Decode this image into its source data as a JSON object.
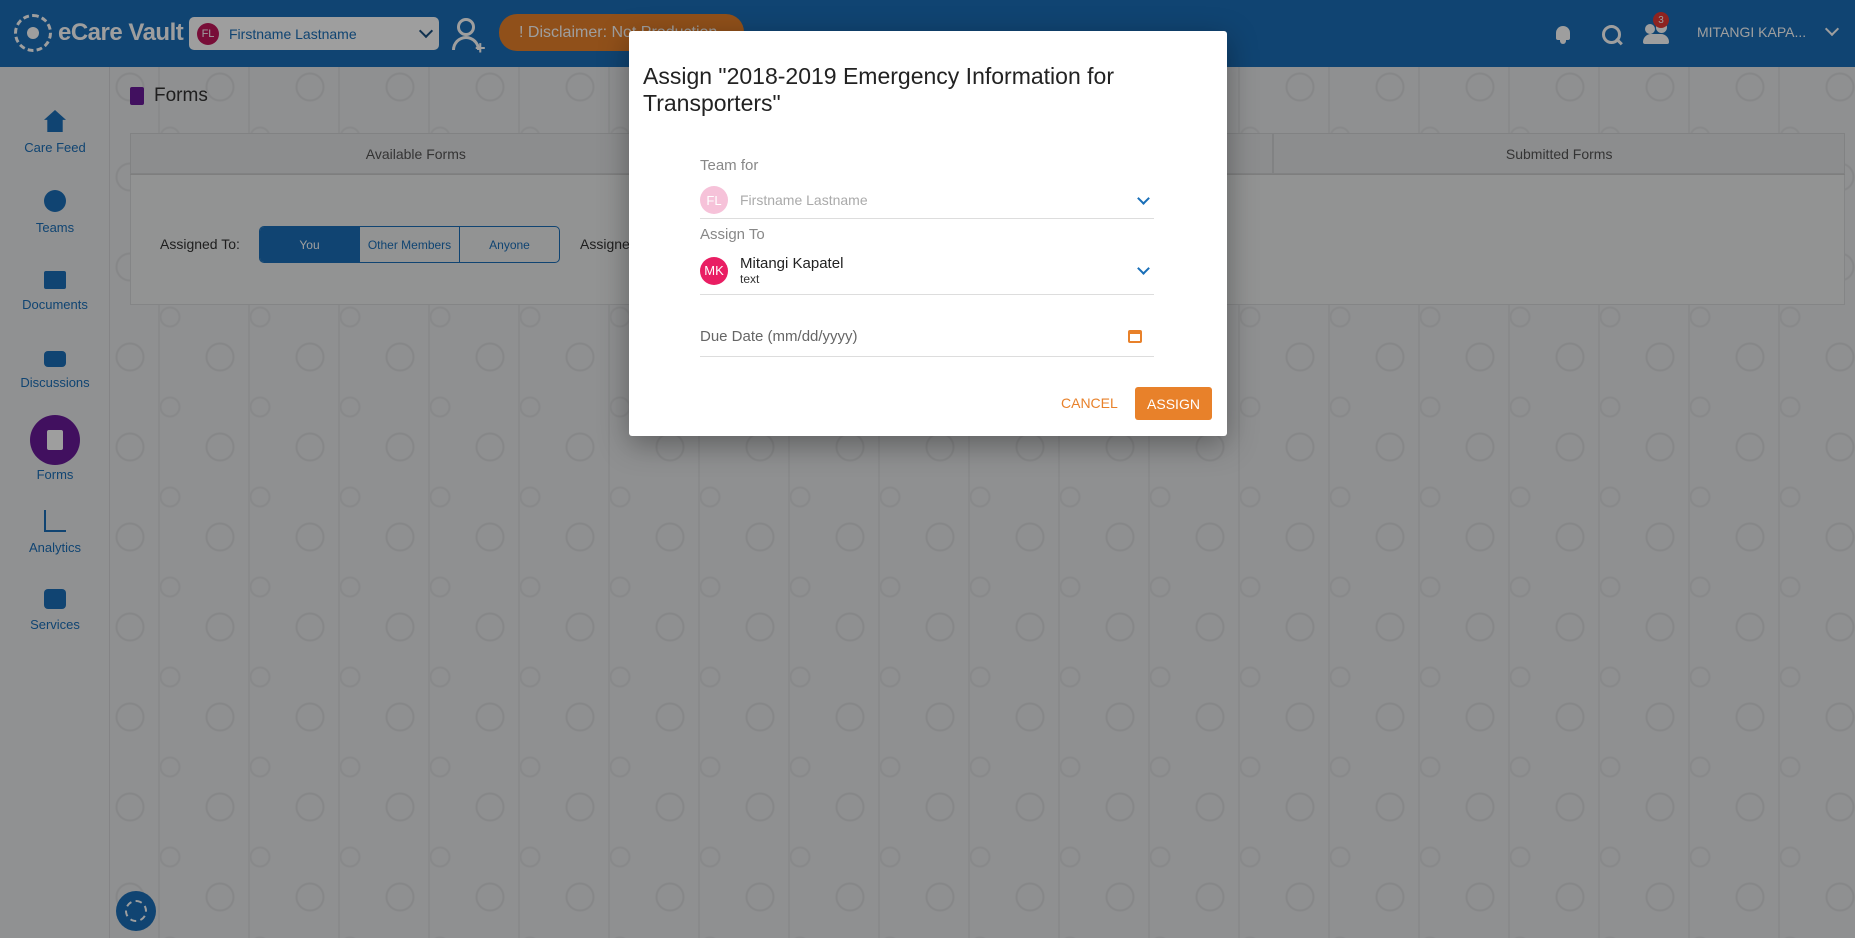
{
  "topbar": {
    "brand": "eCare Vault",
    "patient": {
      "initials": "FL",
      "name": "Firstname Lastname"
    },
    "disclaimer": "! Disclaimer: Not Production",
    "notification_count": "3",
    "user_name": "MITANGI KAPA..."
  },
  "sidebar": {
    "items": [
      {
        "label": "Care Feed",
        "icon": "home-icon"
      },
      {
        "label": "Teams",
        "icon": "teams-icon"
      },
      {
        "label": "Documents",
        "icon": "folder-icon"
      },
      {
        "label": "Discussions",
        "icon": "chat-icon"
      },
      {
        "label": "Forms",
        "icon": "form-icon",
        "active": true
      },
      {
        "label": "Analytics",
        "icon": "chart-icon"
      },
      {
        "label": "Services",
        "icon": "briefcase-icon"
      }
    ]
  },
  "page": {
    "title": "Forms",
    "tabs": [
      "Available Forms",
      "",
      "Submitted Forms"
    ],
    "assigned_to_label": "Assigned To:",
    "assigned_to_options": [
      "You",
      "Other Members",
      "Anyone"
    ],
    "assigned_to_selected": "You",
    "assigned_by_label": "Assigne"
  },
  "modal": {
    "title": "Assign \"2018-2019 Emergency Information for Transporters\"",
    "team_for_label": "Team for",
    "team_for": {
      "initials": "FL",
      "name": "Firstname Lastname"
    },
    "assign_to_label": "Assign To",
    "assign_to": {
      "initials": "MK",
      "name": "Mitangi Kapatel",
      "subtitle": "text"
    },
    "due_date_placeholder": "Due Date (mm/dd/yyyy)",
    "cancel_label": "CANCEL",
    "assign_label": "ASSIGN"
  },
  "colors": {
    "primary": "#1a6fb8",
    "accent": "#e8812a",
    "active_nav": "#6a1b9a"
  }
}
